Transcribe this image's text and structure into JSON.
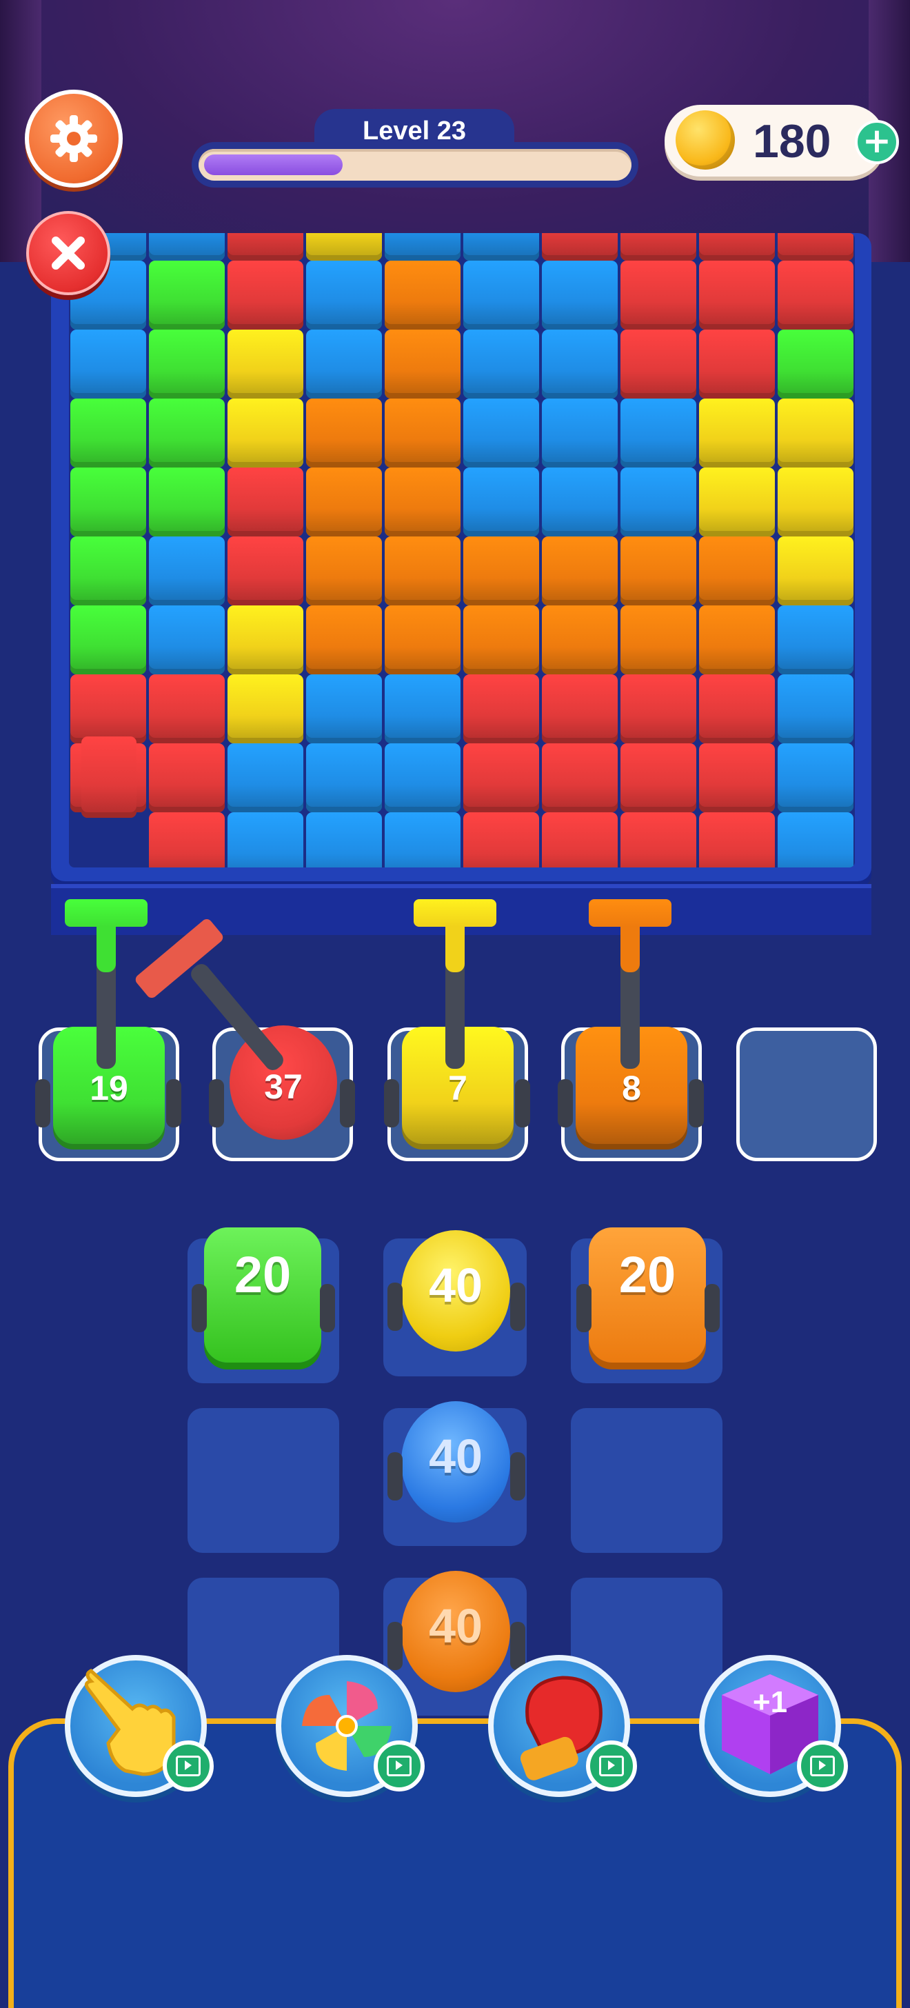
{
  "header": {
    "settings_icon": "gear-icon",
    "close_icon": "close-icon",
    "level_label": "Level 23",
    "level_progress": 0.32,
    "coins": "180",
    "coin_icon": "coin-icon",
    "add_coins_icon": "plus-icon"
  },
  "colors": {
    "blue": "#1f8de6",
    "red": "#e23a3a",
    "green": "#3fe033",
    "yellow": "#f1d21a",
    "orange": "#ee7b0e",
    "board": "#2241b8",
    "accent_purple": "#8a4ee0",
    "panel_border": "#f3b01a"
  },
  "board": {
    "rows": [
      [
        "B",
        "G",
        "R",
        "B",
        "O",
        "B",
        "B",
        "R",
        "R",
        "R"
      ],
      [
        "B",
        "G",
        "Y",
        "B",
        "O",
        "B",
        "B",
        "R",
        "R",
        "G"
      ],
      [
        "G",
        "G",
        "Y",
        "O",
        "O",
        "B",
        "B",
        "B",
        "Y",
        "Y"
      ],
      [
        "G",
        "G",
        "R",
        "O",
        "O",
        "B",
        "B",
        "B",
        "Y",
        "Y"
      ],
      [
        "G",
        "B",
        "R",
        "O",
        "O",
        "O",
        "O",
        "O",
        "O",
        "Y"
      ],
      [
        "G",
        "B",
        "Y",
        "O",
        "O",
        "O",
        "O",
        "O",
        "O",
        "B"
      ],
      [
        "R",
        "R",
        "Y",
        "B",
        "B",
        "R",
        "R",
        "R",
        "R",
        "B"
      ],
      [
        "R",
        "R",
        "B",
        "B",
        "B",
        "R",
        "R",
        "R",
        "R",
        "B"
      ],
      [
        "",
        "R",
        "B",
        "B",
        "B",
        "R",
        "R",
        "R",
        "R",
        "B"
      ]
    ],
    "top_row": [
      "B",
      "B",
      "R",
      "Y",
      "B",
      "B",
      "R",
      "R",
      "R",
      "R"
    ]
  },
  "shooters": [
    {
      "color": "green",
      "count": "19"
    },
    {
      "color": "red",
      "count": "37"
    },
    {
      "color": "yellow",
      "count": "7"
    },
    {
      "color": "orange",
      "count": "8"
    },
    {
      "color": "empty",
      "count": ""
    }
  ],
  "queue": [
    {
      "color": "green",
      "count": "20",
      "shape": "cart"
    },
    {
      "color": "yellow",
      "count": "40",
      "shape": "drum"
    },
    {
      "color": "orange",
      "count": "20",
      "shape": "cart"
    },
    {
      "color": "blue",
      "count": "40",
      "shape": "drum"
    },
    {
      "color": "orange",
      "count": "40",
      "shape": "drum"
    }
  ],
  "boosters": [
    {
      "name": "hand",
      "icon": "hand-pointer-icon"
    },
    {
      "name": "pinwheel",
      "icon": "pinwheel-icon"
    },
    {
      "name": "boxing-glove",
      "icon": "boxing-glove-icon"
    },
    {
      "name": "extra-slot",
      "icon": "purple-cube-icon",
      "label": "+1"
    }
  ],
  "ad_icon": "video-ad-icon"
}
